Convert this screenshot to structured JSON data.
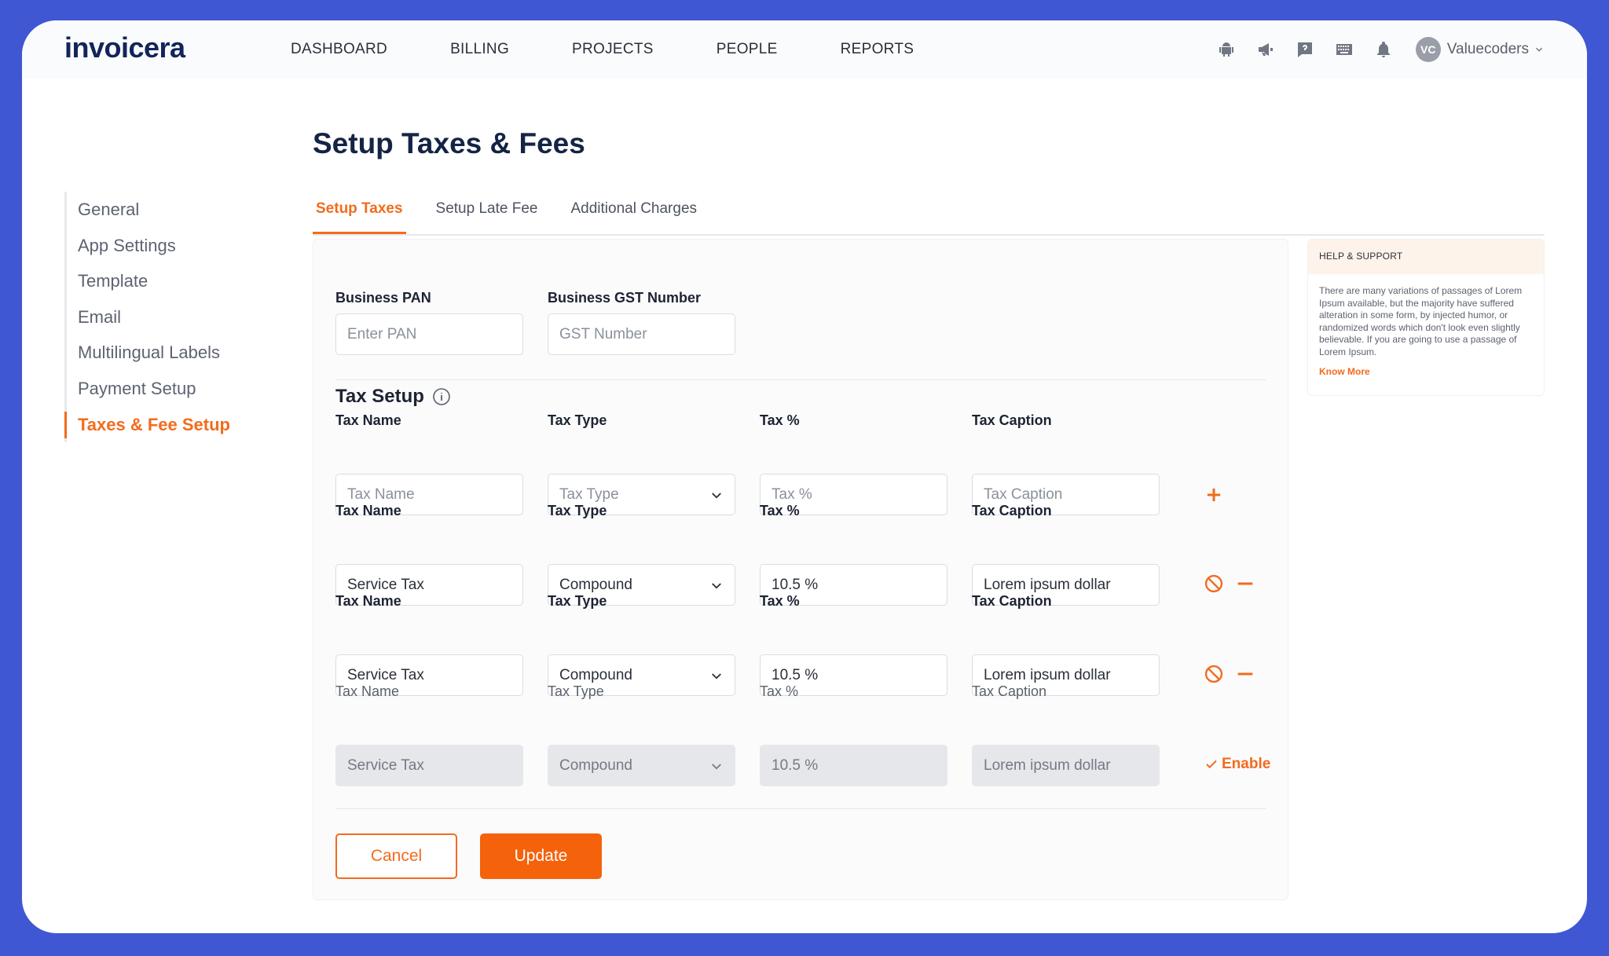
{
  "app": {
    "logo": "invoicera"
  },
  "nav": [
    "DASHBOARD",
    "BILLING",
    "PROJECTS",
    "PEOPLE",
    "REPORTS"
  ],
  "user": {
    "initials": "VC",
    "name": "Valuecoders"
  },
  "sidebar": [
    "General",
    "App Settings",
    "Template",
    "Email",
    "Multilingual Labels",
    "Payment Setup",
    "Taxes & Fee Setup"
  ],
  "page": {
    "title": "Setup Taxes & Fees"
  },
  "tabs": [
    "Setup Taxes",
    "Setup Late Fee",
    "Additional Charges"
  ],
  "business": {
    "pan_label": "Business PAN",
    "pan_placeholder": "Enter PAN",
    "gst_label": "Business GST Number",
    "gst_placeholder": "GST Number"
  },
  "tax_setup": {
    "title": "Tax Setup",
    "labels": {
      "name": "Tax Name",
      "type": "Tax Type",
      "percent": "Tax %",
      "caption": "Tax Caption"
    },
    "rows": [
      {
        "name": "Tax Name",
        "type": "Tax Type",
        "percent": "Tax %",
        "caption": "Tax Caption"
      },
      {
        "name": "Service Tax",
        "type": "Compound",
        "percent": "10.5 %",
        "caption": "Lorem ipsum dollar"
      },
      {
        "name": "Service Tax",
        "type": "Compound",
        "percent": "10.5 %",
        "caption": "Lorem ipsum dollar"
      },
      {
        "name": "Service Tax",
        "type": "Compound",
        "percent": "10.5 %",
        "caption": "Lorem ipsum dollar"
      }
    ],
    "enable_label": "Enable"
  },
  "actions": {
    "cancel": "Cancel",
    "update": "Update"
  },
  "help": {
    "title": "HELP & SUPPORT",
    "body": "There are many variations of passages of Lorem Ipsum available, but the majority have suffered alteration in some form, by injected humor, or randomized words which don't look even slightly believable. If you are going to use a passage of Lorem Ipsum.",
    "link": "Know More"
  },
  "colors": {
    "accent": "#F26B1D",
    "navy": "#152445",
    "frame": "#3F57D2"
  }
}
